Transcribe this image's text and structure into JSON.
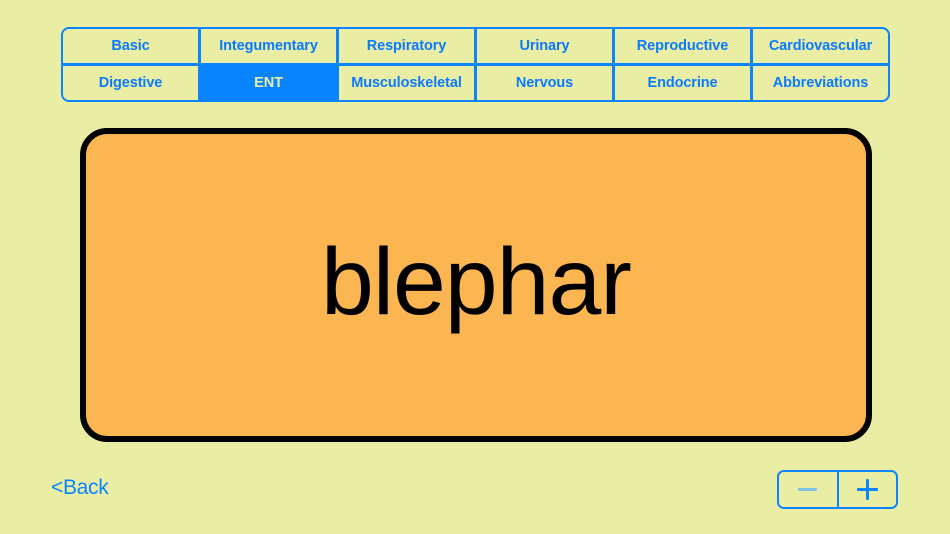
{
  "theme": {
    "background": "#eaeda4",
    "accent_blue": "#0a84ff",
    "card_fill": "#fbb551",
    "card_border": "#000000",
    "disabled_glyph": "#7cc3e8"
  },
  "tabs": {
    "selected": "ENT",
    "items": [
      {
        "label": "Basic",
        "selected": false
      },
      {
        "label": "Integumentary",
        "selected": false
      },
      {
        "label": "Respiratory",
        "selected": false
      },
      {
        "label": "Urinary",
        "selected": false
      },
      {
        "label": "Reproductive",
        "selected": false
      },
      {
        "label": "Cardiovascular",
        "selected": false
      },
      {
        "label": "Digestive",
        "selected": false
      },
      {
        "label": "ENT",
        "selected": true
      },
      {
        "label": "Musculoskeletal",
        "selected": false
      },
      {
        "label": "Nervous",
        "selected": false
      },
      {
        "label": "Endocrine",
        "selected": false
      },
      {
        "label": "Abbreviations",
        "selected": false
      }
    ]
  },
  "card": {
    "term": "blephar"
  },
  "footer": {
    "back_label": "<Back",
    "stepper": {
      "minus_label": "−",
      "minus_icon": "minus-icon",
      "plus_label": "+",
      "plus_icon": "plus-icon"
    }
  }
}
